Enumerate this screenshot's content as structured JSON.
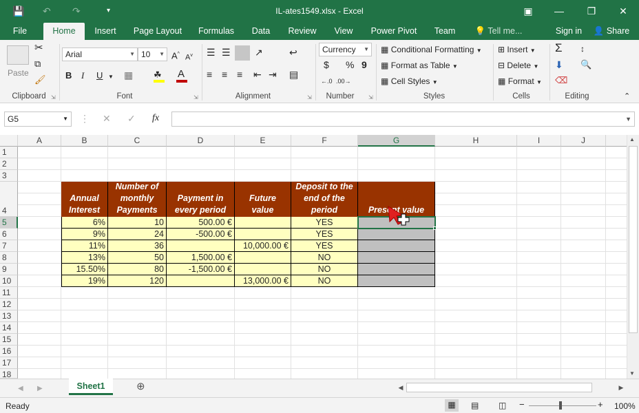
{
  "window": {
    "title": "IL-ates1549.xlsx - Excel"
  },
  "tabs": [
    "File",
    "Home",
    "Insert",
    "Page Layout",
    "Formulas",
    "Data",
    "Review",
    "View",
    "Power Pivot",
    "Team"
  ],
  "tell_me": "Tell me...",
  "sign_in": "Sign in",
  "share": "Share",
  "ribbon": {
    "clipboard": {
      "label": "Clipboard",
      "paste": "Paste"
    },
    "font": {
      "label": "Font",
      "name": "Arial",
      "size": "10",
      "bold": "B",
      "italic": "I",
      "underline": "U"
    },
    "alignment": {
      "label": "Alignment"
    },
    "number": {
      "label": "Number",
      "format": "Currency",
      "currency_symbol": "$",
      "percent": "%",
      "comma": "9"
    },
    "styles": {
      "label": "Styles",
      "conditional": "Conditional Formatting",
      "format_table": "Format as Table",
      "cell_styles": "Cell Styles"
    },
    "cells": {
      "label": "Cells",
      "insert": "Insert",
      "delete": "Delete",
      "format": "Format"
    },
    "editing": {
      "label": "Editing"
    }
  },
  "formula_bar": {
    "name_box": "G5",
    "fx": "fx",
    "content": ""
  },
  "columns": [
    "A",
    "B",
    "C",
    "D",
    "E",
    "F",
    "G",
    "H",
    "I",
    "J"
  ],
  "rows": [
    "1",
    "2",
    "3",
    "4",
    "5",
    "6",
    "7",
    "8",
    "9",
    "10",
    "11",
    "12",
    "13",
    "14",
    "15",
    "16",
    "17",
    "18"
  ],
  "table": {
    "headers": [
      "Annual\nInterest",
      "Number of\nmonthly\nPayments",
      "Payment in\nevery period",
      "Future\nvalue",
      "Deposit to the\nend of the\nperiod",
      "Present value"
    ],
    "rows": [
      [
        "6%",
        "10",
        "500.00 €",
        "",
        "YES",
        ""
      ],
      [
        "9%",
        "24",
        "-500.00 €",
        "",
        "YES",
        ""
      ],
      [
        "11%",
        "36",
        "",
        "10,000.00 €",
        "YES",
        ""
      ],
      [
        "13%",
        "50",
        "1,500.00 €",
        "",
        "NO",
        ""
      ],
      [
        "15.50%",
        "80",
        "-1,500.00 €",
        "",
        "NO",
        ""
      ],
      [
        "19%",
        "120",
        "",
        "13,000.00 €",
        "NO",
        ""
      ]
    ]
  },
  "sheet_tabs": [
    "Sheet1"
  ],
  "status": {
    "ready": "Ready",
    "zoom": "100%"
  },
  "colors": {
    "excel_green": "#217346",
    "header_fill": "#993300",
    "data_fill": "#ffffc0",
    "present_fill": "#c0c0c0"
  }
}
